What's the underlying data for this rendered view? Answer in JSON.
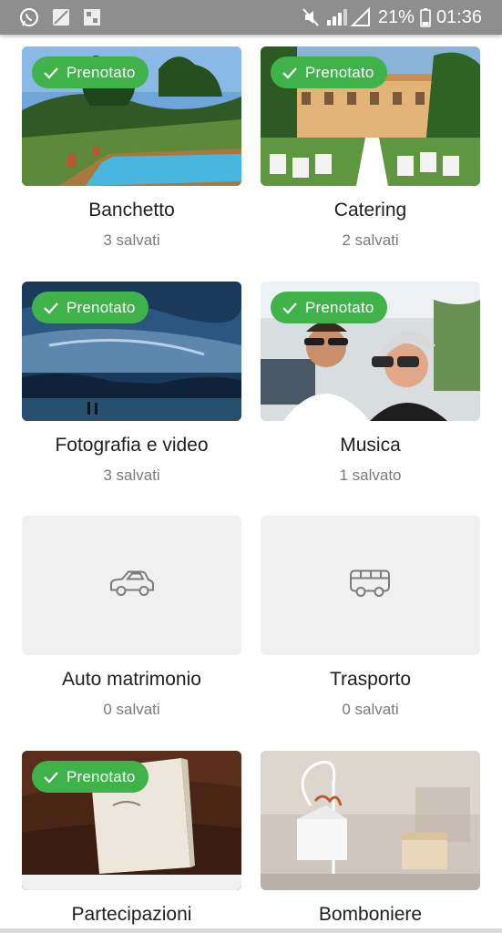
{
  "status_bar": {
    "battery": "21%",
    "time": "01:36",
    "icons_left": [
      "whatsapp-icon",
      "gallery-icon",
      "image-icon"
    ],
    "icons_right": [
      "mute-icon",
      "signal-icon",
      "battery-icon"
    ]
  },
  "badge_label": "Prenotato",
  "categories": [
    {
      "title": "Banchetto",
      "saved": "3 salvati",
      "booked": true,
      "photo": "pool-photo"
    },
    {
      "title": "Catering",
      "saved": "2 salvati",
      "booked": true,
      "photo": "villa-photo"
    },
    {
      "title": "Fotografia e video",
      "saved": "3 salvati",
      "booked": true,
      "photo": "lake-photo"
    },
    {
      "title": "Musica",
      "saved": "1 salvato",
      "booked": true,
      "photo": "couple-photo"
    },
    {
      "title": "Auto matrimonio",
      "saved": "0 salvati",
      "booked": false,
      "icon": "car-icon"
    },
    {
      "title": "Trasporto",
      "saved": "0 salvati",
      "booked": false,
      "icon": "bus-icon"
    },
    {
      "title": "Partecipazioni",
      "saved": "",
      "booked": true,
      "photo": "invitation-photo"
    },
    {
      "title": "Bomboniere",
      "saved": "",
      "booked": false,
      "photo": "favor-photo"
    }
  ],
  "colors": {
    "badge": "#3fb24a",
    "placeholder": "#f0f0f0",
    "statusbar": "#8e8e8e"
  }
}
